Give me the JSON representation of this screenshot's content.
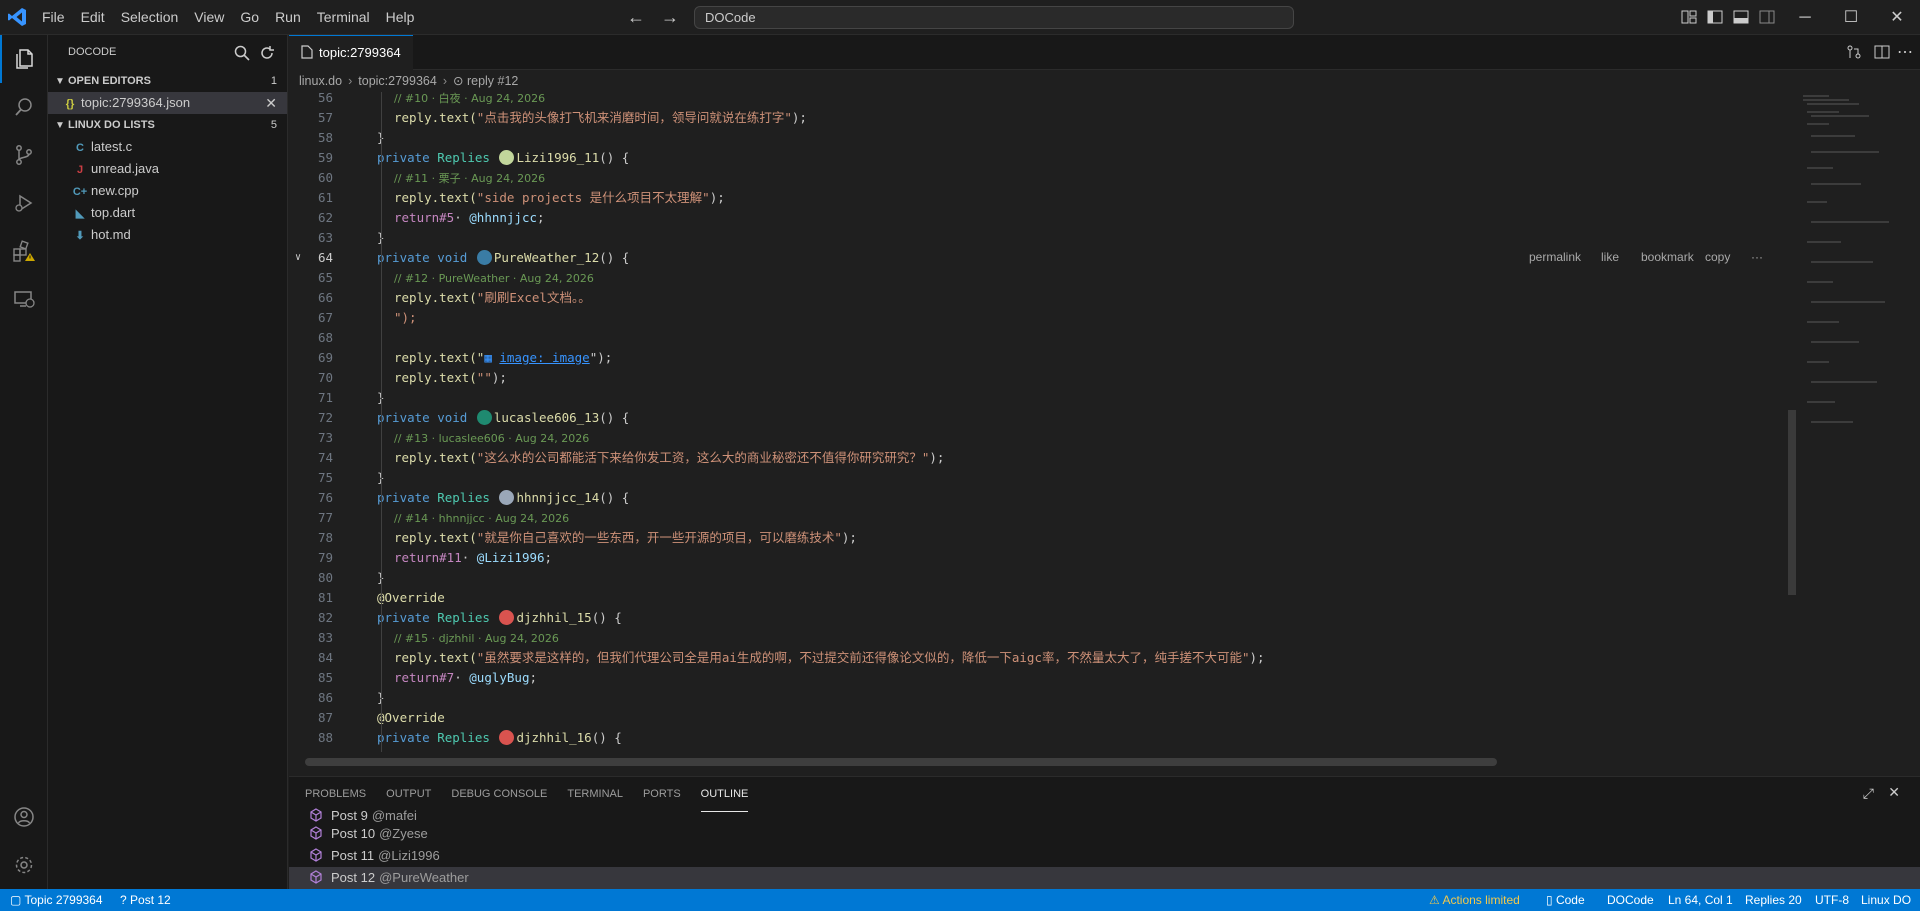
{
  "menu": [
    "File",
    "Edit",
    "Selection",
    "View",
    "Go",
    "Run",
    "Terminal",
    "Help"
  ],
  "command_center": "DOCode",
  "sidebar": {
    "title": "DOCODE",
    "open_editors": {
      "label": "OPEN EDITORS",
      "count": "1",
      "items": [
        {
          "icon": "{}",
          "name": "topic:2799364.json"
        }
      ]
    },
    "linux_do_lists": {
      "label": "LINUX DO LISTS",
      "count": "5"
    },
    "files": [
      {
        "icon": "C",
        "name": "latest.c",
        "color": "#519aba"
      },
      {
        "icon": "J",
        "name": "unread.java",
        "color": "#cc3e44"
      },
      {
        "icon": "C+",
        "name": "new.cpp",
        "color": "#519aba"
      },
      {
        "icon": "◣",
        "name": "top.dart",
        "color": "#519aba"
      },
      {
        "icon": "⬇",
        "name": "hot.md",
        "color": "#519aba"
      }
    ]
  },
  "tab": {
    "label": "topic:2799364"
  },
  "breadcrumb": [
    "linux.do",
    "topic:2799364",
    "reply #12"
  ],
  "hover_actions": [
    "permalink",
    "like",
    "bookmark",
    "copy",
    "···"
  ],
  "code": [
    {
      "n": "56",
      "kind": "comment",
      "text": "// #10 · 白夜 · Aug 24, 2026"
    },
    {
      "n": "57",
      "kind": "call",
      "text": "\"点击我的头像打飞机来消磨时间，领导问就说在练打字\""
    },
    {
      "n": "58",
      "kind": "close",
      "text": "}"
    },
    {
      "n": "59",
      "kind": "decl",
      "mod": "private",
      "type": "Replies",
      "name": "Lizi1996_11",
      "avatar": "#c2d69b"
    },
    {
      "n": "60",
      "kind": "comment",
      "text": "// #11 · 栗子 · Aug 24, 2026"
    },
    {
      "n": "61",
      "kind": "call",
      "text": "\"side projects 是什么项目不太理解\""
    },
    {
      "n": "62",
      "kind": "return",
      "num": "#5",
      "mention": "@hhnnjjcc"
    },
    {
      "n": "63",
      "kind": "close",
      "text": "}"
    },
    {
      "n": "64",
      "kind": "decl",
      "mod": "private",
      "type": "void",
      "name": "PureWeather_12",
      "avatar": "#3a7ca5"
    },
    {
      "n": "65",
      "kind": "comment",
      "text": "// #12 · PureWeather · Aug 24, 2026"
    },
    {
      "n": "66",
      "kind": "call",
      "text": "\"刷刷Excel文档。。"
    },
    {
      "n": "67",
      "kind": "raw",
      "text": "\");"
    },
    {
      "n": "68",
      "kind": "blank",
      "text": ""
    },
    {
      "n": "69",
      "kind": "image",
      "pre": "reply.text(\"",
      "link": "image: image",
      "post": "\");"
    },
    {
      "n": "70",
      "kind": "call",
      "text": "\"\""
    },
    {
      "n": "71",
      "kind": "close",
      "text": "}"
    },
    {
      "n": "72",
      "kind": "decl",
      "mod": "private",
      "type": "void",
      "name": "lucaslee606_13",
      "avatar": "#1f8a70"
    },
    {
      "n": "73",
      "kind": "comment",
      "text": "// #13 · lucaslee606 · Aug 24, 2026"
    },
    {
      "n": "74",
      "kind": "call",
      "text": "\"这么水的公司都能活下来给你发工资，这么大的商业秘密还不值得你研究研究？\""
    },
    {
      "n": "75",
      "kind": "close",
      "text": "}"
    },
    {
      "n": "76",
      "kind": "decl",
      "mod": "private",
      "type": "Replies",
      "name": "hhnnjjcc_14",
      "avatar": "#9aa7b8"
    },
    {
      "n": "77",
      "kind": "comment",
      "text": "// #14 · hhnnjjcc · Aug 24, 2026"
    },
    {
      "n": "78",
      "kind": "call",
      "text": "\"就是你自己喜欢的一些东西，开一些开源的项目，可以磨练技术\""
    },
    {
      "n": "79",
      "kind": "return",
      "num": "#11",
      "mention": "@Lizi1996"
    },
    {
      "n": "80",
      "kind": "close",
      "text": "}"
    },
    {
      "n": "81",
      "kind": "annot",
      "text": "@Override"
    },
    {
      "n": "82",
      "kind": "decl",
      "mod": "private",
      "type": "Replies",
      "name": "djzhhil_15",
      "avatar": "#d9534f"
    },
    {
      "n": "83",
      "kind": "comment",
      "text": "// #15 · djzhhil · Aug 24, 2026"
    },
    {
      "n": "84",
      "kind": "call",
      "text": "\"虽然要求是这样的，但我们代理公司全是用ai生成的啊，不过提交前还得像论文似的，降低一下aigc率，不然量太大了，纯手搓不大可能\""
    },
    {
      "n": "85",
      "kind": "return",
      "num": "#7",
      "mention": "@uglyBug"
    },
    {
      "n": "86",
      "kind": "close",
      "text": "}"
    },
    {
      "n": "87",
      "kind": "annot",
      "text": "@Override"
    },
    {
      "n": "88",
      "kind": "decl",
      "mod": "private",
      "type": "Replies",
      "name": "djzhhil_16",
      "avatar": "#d9534f"
    }
  ],
  "current_line": "64",
  "panel": {
    "tabs": [
      "PROBLEMS",
      "OUTPUT",
      "DEBUG CONSOLE",
      "TERMINAL",
      "PORTS",
      "OUTLINE"
    ],
    "active_tab": "OUTLINE",
    "outline": [
      {
        "post": "Post 9",
        "who": "@mafei"
      },
      {
        "post": "Post 10",
        "who": "@Zyese"
      },
      {
        "post": "Post 11",
        "who": "@Lizi1996"
      },
      {
        "post": "Post 12",
        "who": "@PureWeather"
      }
    ]
  },
  "status": {
    "topic": "Topic 2799364",
    "post": "Post 12",
    "actions": "Actions limited",
    "mode": "Code",
    "app": "DOCode",
    "position": "Ln 64, Col 1",
    "replies": "Replies 20",
    "encoding": "UTF-8",
    "site": "Linux DO"
  }
}
